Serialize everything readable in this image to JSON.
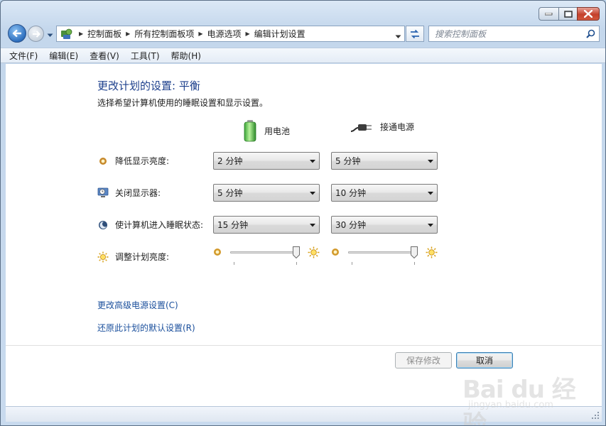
{
  "window": {
    "caption_buttons": [
      "minimize-icon",
      "maximize-icon",
      "close-icon"
    ],
    "close_color": "#c4402b"
  },
  "navigation": {
    "breadcrumbs": [
      "控制面板",
      "所有控制面板项",
      "电源选项",
      "编辑计划设置"
    ],
    "search_placeholder": "搜索控制面板"
  },
  "menu": [
    "文件(F)",
    "编辑(E)",
    "查看(V)",
    "工具(T)",
    "帮助(H)"
  ],
  "page": {
    "title": "更改计划的设置: 平衡",
    "subtitle": "选择希望计算机使用的睡眠设置和显示设置。",
    "columns": {
      "battery": "用电池",
      "plugged_in": "接通电源"
    },
    "settings": [
      {
        "label": "降低显示亮度:",
        "icon": "dim-display-icon",
        "battery": "2 分钟",
        "plugged_in": "5 分钟"
      },
      {
        "label": "关闭显示器:",
        "icon": "display-off-icon",
        "battery": "5 分钟",
        "plugged_in": "10 分钟"
      },
      {
        "label": "使计算机进入睡眠状态:",
        "icon": "sleep-icon",
        "battery": "15 分钟",
        "plugged_in": "30 分钟"
      }
    ],
    "brightness": {
      "label": "调整计划亮度:",
      "battery_level": 0.97,
      "plugged_in_level": 0.97
    },
    "links": {
      "advanced": "更改高级电源设置(C)",
      "restore": "还原此计划的默认设置(R)"
    },
    "buttons": {
      "save": "保存修改",
      "cancel": "取消"
    }
  },
  "watermark": {
    "brand": "Bai du 经验",
    "url": "jingyan.baidu.com"
  },
  "colors": {
    "title": "#1c3f8c",
    "link": "#1a4f9c"
  }
}
